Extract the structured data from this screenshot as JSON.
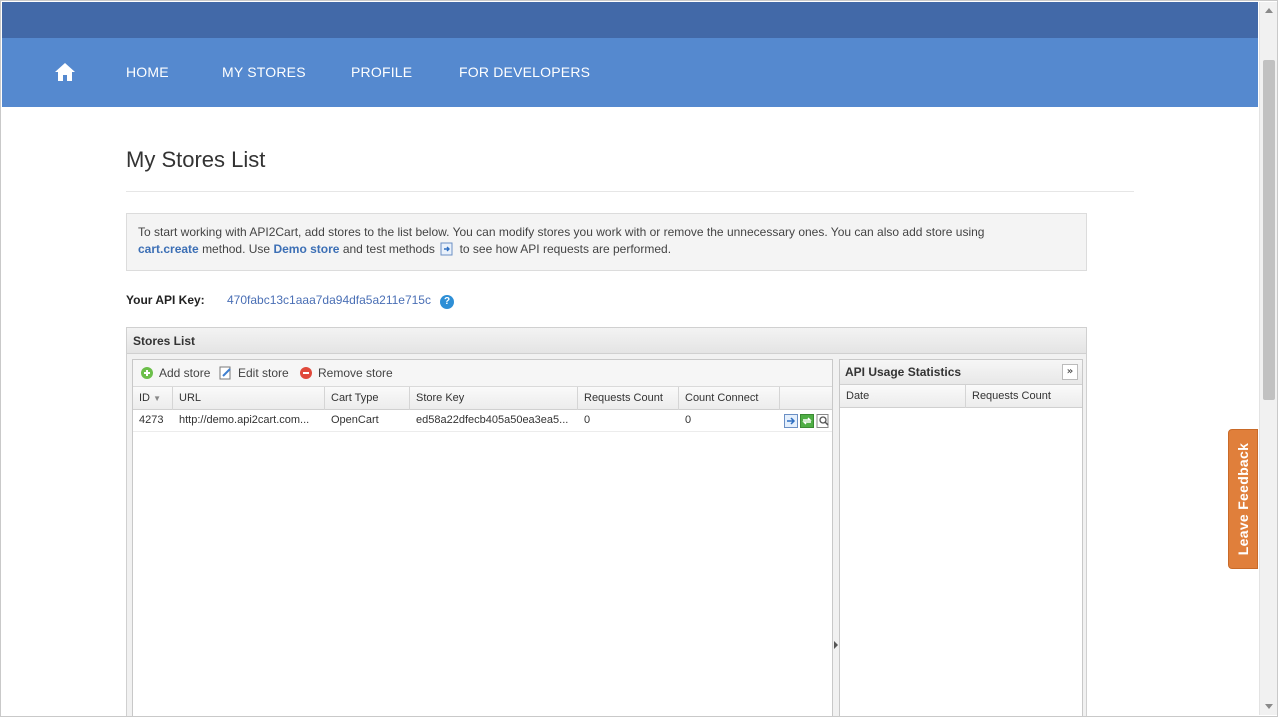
{
  "nav": {
    "items": [
      {
        "label": "HOME"
      },
      {
        "label": "MY STORES"
      },
      {
        "label": "PROFILE"
      },
      {
        "label": "FOR DEVELOPERS"
      }
    ]
  },
  "page": {
    "title": "My Stores List",
    "info": {
      "text1": "To start working with API2Cart, add stores to the list below. You can modify stores you work with or remove the unnecessary ones. You can also add store using",
      "link1": "cart.create",
      "text2": "method. Use",
      "link2": "Demo store",
      "text3": "and test methods",
      "text4": "to see how API requests are performed."
    },
    "api_key_label": "Your API Key:",
    "api_key_value": "470fabc13c1aaa7da94dfa5a211e715c"
  },
  "stores_panel": {
    "title": "Stores List",
    "toolbar": {
      "add": "Add store",
      "edit": "Edit store",
      "remove": "Remove store"
    },
    "columns": [
      "ID",
      "URL",
      "Cart Type",
      "Store Key",
      "Requests Count",
      "Count Connect"
    ],
    "rows": [
      {
        "id": "4273",
        "url": "http://demo.api2cart.com...",
        "cart_type": "OpenCart",
        "store_key": "ed58a22dfecb405a50ea3ea5...",
        "requests_count": "0",
        "count_connect": "0"
      }
    ]
  },
  "stats_panel": {
    "title": "API Usage Statistics",
    "columns": [
      "Date",
      "Requests Count"
    ]
  },
  "feedback": {
    "label": "Leave Feedback"
  },
  "colors": {
    "topbar": "#4269a8",
    "nav": "#5589cf",
    "link": "#3c6fb5",
    "feedback": "#e07f3b"
  }
}
